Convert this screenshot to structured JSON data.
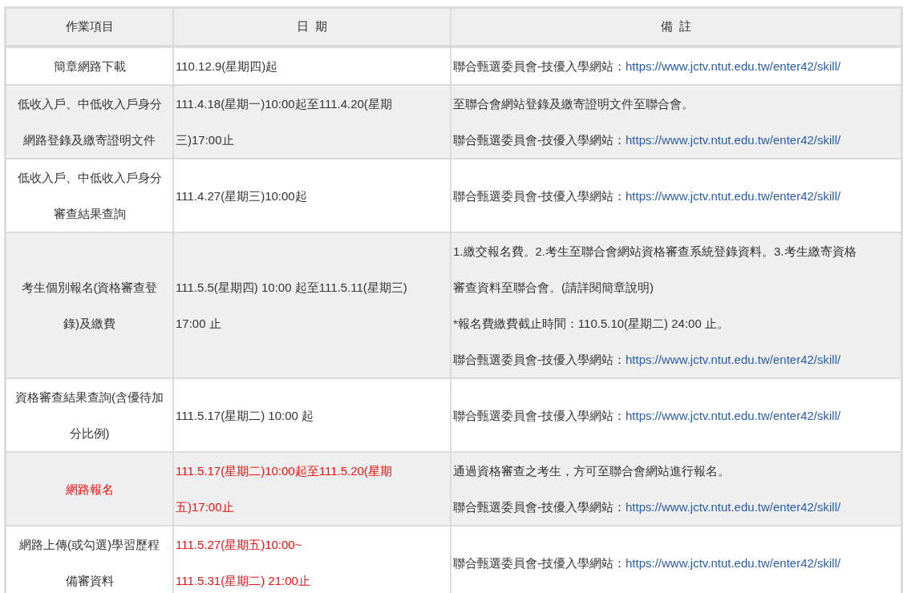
{
  "table": {
    "columns": [
      "作業項目",
      "日  期",
      "備  註"
    ],
    "rows": [
      {
        "item": {
          "lines": [
            "簡章網路下載"
          ],
          "highlighted": false
        },
        "date": {
          "lines": [
            "110.12.9(星期四)起"
          ],
          "highlighted": false
        },
        "notes": [
          {
            "lines": [
              "聯合甄選委員會-技優入學網站："
            ],
            "link": "https://www.jctv.ntut.edu.tw/enter42/skill/"
          }
        ]
      },
      {
        "item": {
          "lines": [
            "低收入戶、中低收入戶身分",
            "網路登錄及繳寄證明文件"
          ],
          "highlighted": false
        },
        "date": {
          "lines": [
            "111.4.18(星期一)10:00起至111.4.20(星期",
            "三)17:00止"
          ],
          "highlighted": false
        },
        "notes": [
          {
            "lines": [
              "至聯合會網站登錄及繳寄證明文件至聯合會。"
            ]
          },
          {
            "lines": [
              "聯合甄選委員會-技優入學網站："
            ],
            "link": "https://www.jctv.ntut.edu.tw/enter42/skill/"
          }
        ]
      },
      {
        "item": {
          "lines": [
            "低收入戶、中低收入戶身分",
            "審查結果查詢"
          ],
          "highlighted": false
        },
        "date": {
          "lines": [
            "111.4.27(星期三)10:00起"
          ],
          "highlighted": false
        },
        "notes": [
          {
            "lines": [
              "聯合甄選委員會-技優入學網站："
            ],
            "link": "https://www.jctv.ntut.edu.tw/enter42/skill/"
          }
        ]
      },
      {
        "item": {
          "lines": [
            "考生個別報名(資格審查登",
            "錄)及繳費"
          ],
          "highlighted": false
        },
        "date": {
          "lines": [
            "111.5.5(星期四) 10:00 起至111.5.11(星期三)",
            "17:00 止"
          ],
          "highlighted": false
        },
        "notes": [
          {
            "lines": [
              "1.繳交報名費。2.考生至聯合會網站資格審查系統登錄資料。3.考生繳寄資格",
              "審查資料至聯合會。(請詳閱簡章說明)"
            ]
          },
          {
            "lines": [
              "*報名費繳費截止時間：110.5.10(星期二) 24:00 止。"
            ]
          },
          {
            "lines": [
              "聯合甄選委員會-技優入學網站："
            ],
            "link": "https://www.jctv.ntut.edu.tw/enter42/skill/"
          }
        ]
      },
      {
        "item": {
          "lines": [
            "資格審查結果查詢(含優待加",
            "分比例)"
          ],
          "highlighted": false
        },
        "date": {
          "lines": [
            "111.5.17(星期二) 10:00 起"
          ],
          "highlighted": false
        },
        "notes": [
          {
            "lines": [
              "聯合甄選委員會-技優入學網站："
            ],
            "link": "https://www.jctv.ntut.edu.tw/enter42/skill/"
          }
        ]
      },
      {
        "item": {
          "lines": [
            "網路報名"
          ],
          "highlighted": true
        },
        "date": {
          "lines": [
            "111.5.17(星期二)10:00起至111.5.20(星期",
            "五)17:00止"
          ],
          "highlighted": true
        },
        "notes": [
          {
            "lines": [
              "通過資格審查之考生，方可至聯合會網站進行報名。"
            ]
          },
          {
            "lines": [
              "聯合甄選委員會-技優入學網站："
            ],
            "link": "https://www.jctv.ntut.edu.tw/enter42/skill/"
          }
        ]
      },
      {
        "item": {
          "lines": [
            "網路上傳(或勾選)學習歷程",
            "備審資料"
          ],
          "highlighted": false
        },
        "date": {
          "lines": [
            "111.5.27(星期五)10:00~",
            "111.5.31(星期二) 21:00止"
          ],
          "highlighted": true
        },
        "notes": [
          {
            "lines": [
              "聯合甄選委員會-技優入學網站："
            ],
            "link": "https://www.jctv.ntut.edu.tw/enter42/skill/"
          }
        ]
      }
    ]
  }
}
